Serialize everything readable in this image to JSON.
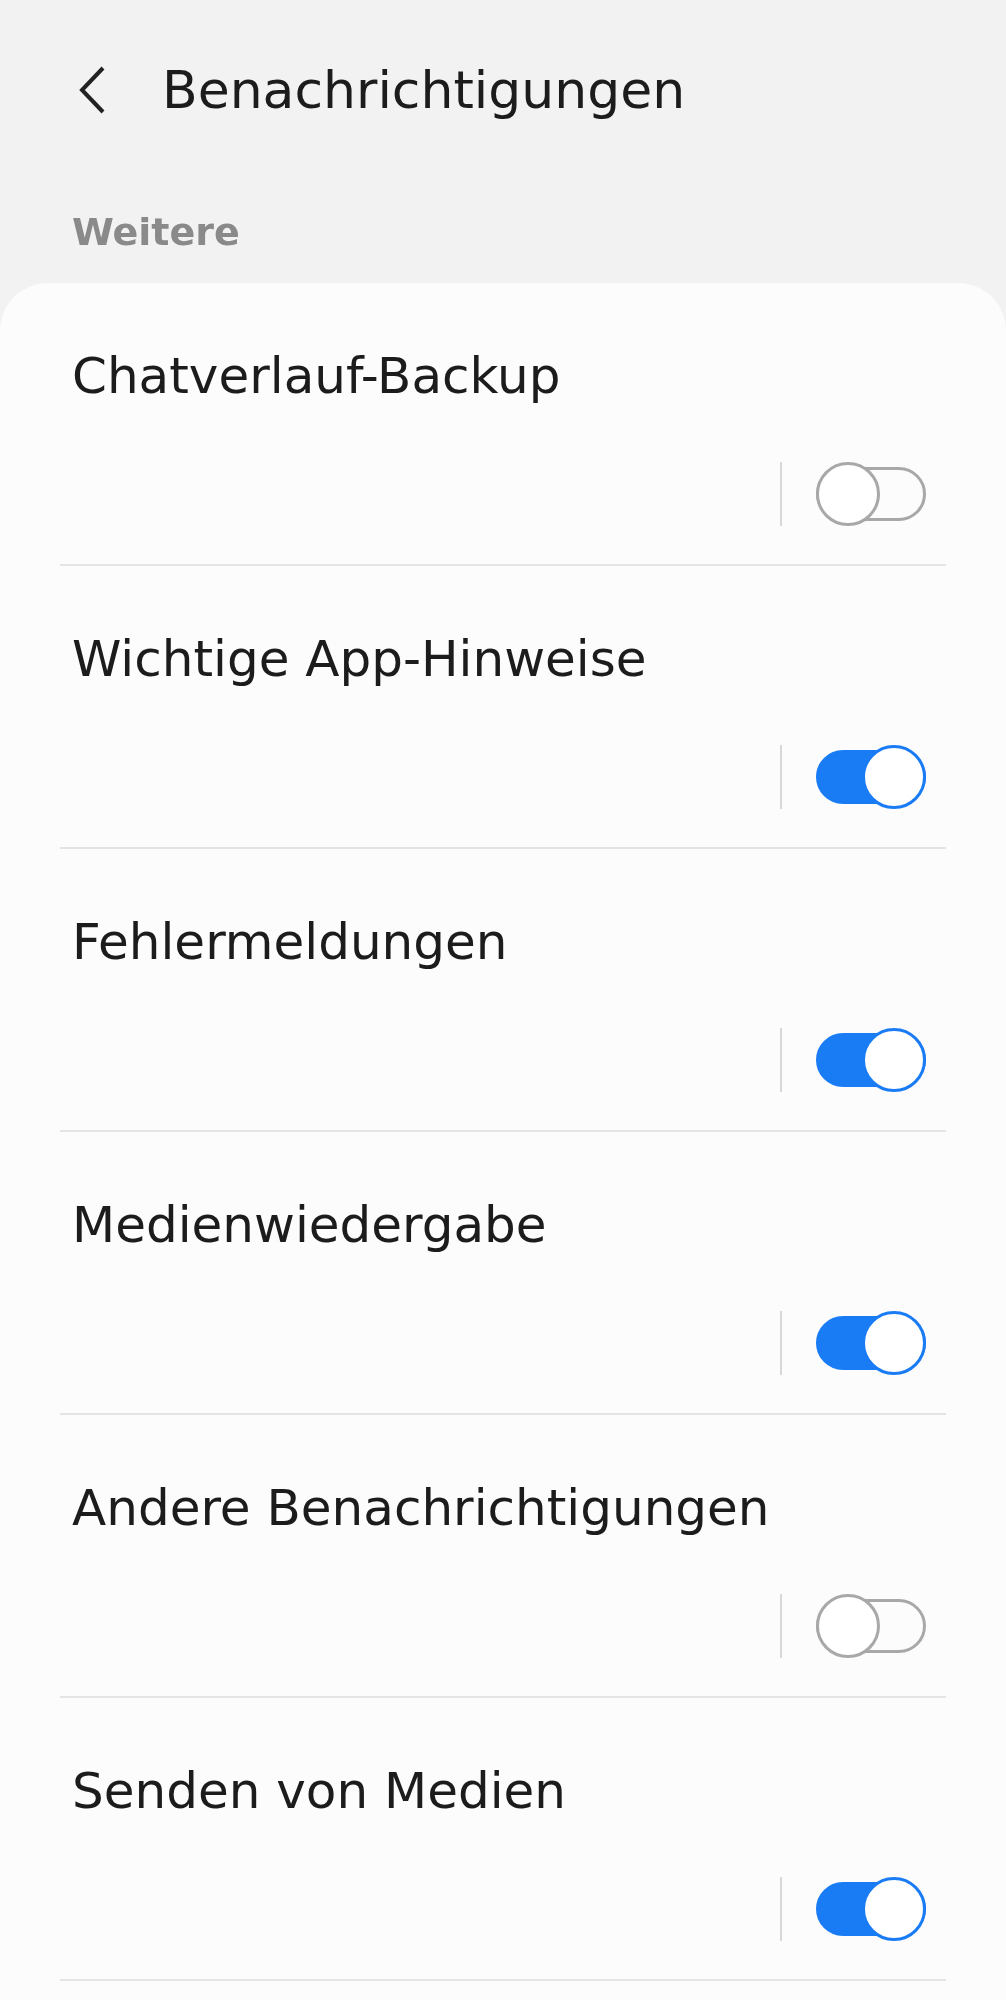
{
  "header": {
    "title": "Benachrichtigungen"
  },
  "section": {
    "title": "Weitere"
  },
  "items": [
    {
      "label": "Chatverlauf-Backup",
      "on": false
    },
    {
      "label": "Wichtige App-Hinweise",
      "on": true
    },
    {
      "label": "Fehlermeldungen",
      "on": true
    },
    {
      "label": "Medienwiedergabe",
      "on": true
    },
    {
      "label": "Andere Benachrichtigungen",
      "on": false
    },
    {
      "label": "Senden von Medien",
      "on": true
    }
  ]
}
